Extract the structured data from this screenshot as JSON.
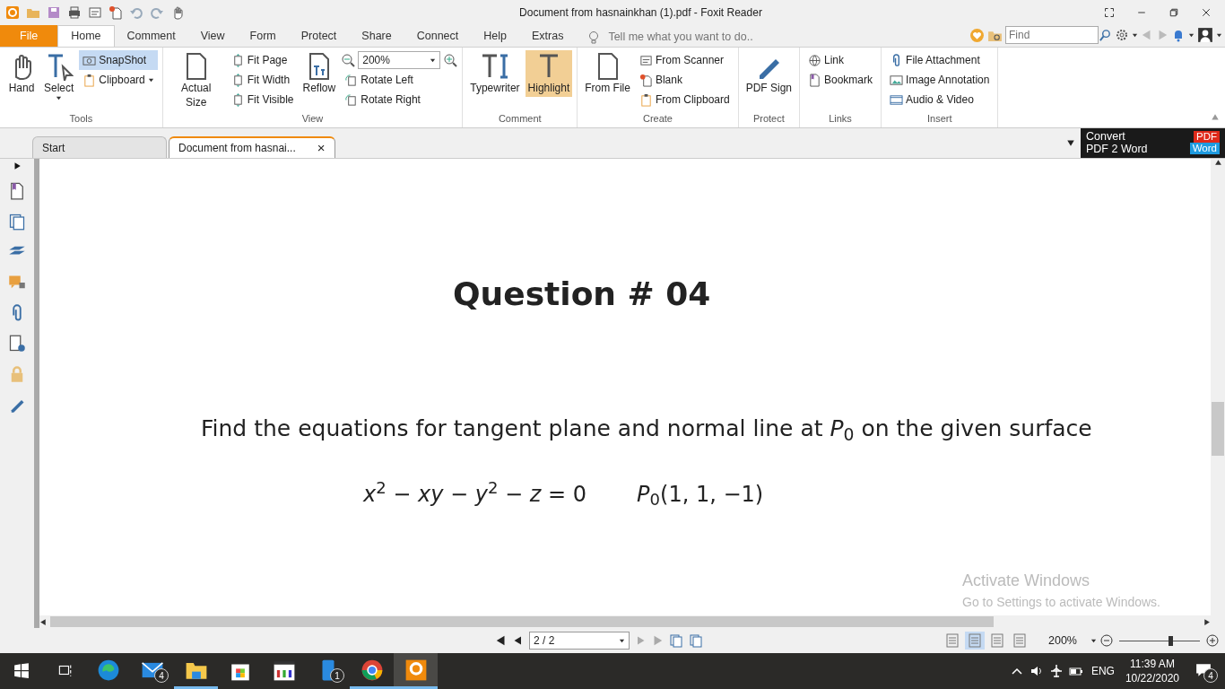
{
  "window": {
    "title": "Document from hasnainkhan (1).pdf - Foxit Reader"
  },
  "quick_access": [
    {
      "kind": "app"
    },
    {
      "kind": "open"
    },
    {
      "kind": "save"
    },
    {
      "kind": "print"
    },
    {
      "kind": "scan"
    },
    {
      "kind": "new"
    },
    {
      "kind": "undo"
    },
    {
      "kind": "redo"
    },
    {
      "kind": "hand"
    }
  ],
  "ribbon_tabs": [
    {
      "label": "File",
      "kind": "file",
      "selected": false
    },
    {
      "label": "Home",
      "kind": "tab",
      "selected": true
    },
    {
      "label": "Comment",
      "kind": "tab",
      "selected": false
    },
    {
      "label": "View",
      "kind": "tab",
      "selected": false
    },
    {
      "label": "Form",
      "kind": "tab",
      "selected": false
    },
    {
      "label": "Protect",
      "kind": "tab",
      "selected": false
    },
    {
      "label": "Share",
      "kind": "tab",
      "selected": false
    },
    {
      "label": "Connect",
      "kind": "tab",
      "selected": false
    },
    {
      "label": "Help",
      "kind": "tab",
      "selected": false
    },
    {
      "label": "Extras",
      "kind": "tab",
      "selected": false
    }
  ],
  "tell_me": {
    "placeholder": "Tell me what you want to do.."
  },
  "find": {
    "placeholder": "Find"
  },
  "ribbon_groups": [
    {
      "label": "Tools",
      "columns": [
        [
          {
            "label": "Hand",
            "kind": "large",
            "active": false
          }
        ],
        [
          {
            "label": "Select",
            "kind": "large",
            "active": false,
            "dropdown": true
          }
        ],
        [
          {
            "label": "SnapShot",
            "kind": "small",
            "active": true
          },
          {
            "label": "Clipboard",
            "kind": "small",
            "active": false,
            "dropdown": true
          }
        ]
      ]
    },
    {
      "label": "View",
      "columns": [
        [
          {
            "label": "Actual Size",
            "kind": "large",
            "active": false
          }
        ],
        [
          {
            "label": "Fit Page",
            "kind": "small",
            "active": false
          },
          {
            "label": "Fit Width",
            "kind": "small",
            "active": false
          },
          {
            "label": "Fit Visible",
            "kind": "small",
            "active": false
          }
        ],
        [
          {
            "label": "Reflow",
            "kind": "large",
            "active": false
          }
        ],
        [
          {
            "label": "200%",
            "kind": "zoom",
            "active": false
          },
          {
            "label": "Rotate Left",
            "kind": "small",
            "active": false
          },
          {
            "label": "Rotate Right",
            "kind": "small",
            "active": false
          }
        ]
      ]
    },
    {
      "label": "Comment",
      "columns": [
        [
          {
            "label": "Typewriter",
            "kind": "large",
            "active": false
          }
        ],
        [
          {
            "label": "Highlight",
            "kind": "large",
            "active": true
          }
        ]
      ]
    },
    {
      "label": "Create",
      "columns": [
        [
          {
            "label": "From File",
            "kind": "large",
            "active": false
          }
        ],
        [
          {
            "label": "From Scanner",
            "kind": "small",
            "active": false
          },
          {
            "label": "Blank",
            "kind": "small",
            "active": false
          },
          {
            "label": "From Clipboard",
            "kind": "small",
            "active": false
          }
        ]
      ]
    },
    {
      "label": "Protect",
      "columns": [
        [
          {
            "label": "PDF Sign",
            "kind": "large",
            "active": false
          }
        ]
      ]
    },
    {
      "label": "Links",
      "columns": [
        [
          {
            "label": "Link",
            "kind": "small",
            "active": false
          },
          {
            "label": "Bookmark",
            "kind": "small",
            "active": false
          }
        ]
      ]
    },
    {
      "label": "Insert",
      "columns": [
        [
          {
            "label": "File Attachment",
            "kind": "small",
            "active": false
          },
          {
            "label": "Image Annotation",
            "kind": "small",
            "active": false
          },
          {
            "label": "Audio & Video",
            "kind": "small",
            "active": false
          }
        ]
      ]
    }
  ],
  "doc_tabs": [
    {
      "label": "Start",
      "selected": false
    },
    {
      "label": "Document from hasnai...",
      "selected": true,
      "close": "×"
    }
  ],
  "convert_ad": {
    "line_1": "Convert",
    "line_2": "PDF 2 Word",
    "badge_1": "PDF",
    "badge_2": "Word"
  },
  "sidebar": [
    {
      "kind": "bookmark"
    },
    {
      "kind": "pages"
    },
    {
      "kind": "layers"
    },
    {
      "kind": "comments"
    },
    {
      "kind": "clip"
    },
    {
      "kind": "signature"
    },
    {
      "kind": "lock"
    },
    {
      "kind": "pen"
    }
  ],
  "document": {
    "heading": "Question # 04",
    "sentence": "Find the equations for tangent plane and normal line at *P*$_{0}$ on the given surface",
    "equation": "*x*$^{2}$ − *xy* − *y*$^{2}$ − *z* = 0",
    "point": "*P*$_{0}$(1, 1, −1)"
  },
  "activation": {
    "title": "Activate Windows",
    "text": "Go to Settings to activate Windows."
  },
  "status_bar": {
    "page": "2 / 2",
    "zoom": "200%",
    "zoom_level": {
      "level": 0.64
    },
    "views": [
      {
        "selected": false
      },
      {
        "selected": true
      },
      {
        "selected": false
      },
      {
        "selected": false
      }
    ]
  },
  "taskbar": {
    "apps": [
      {
        "kind": "edge",
        "running": false,
        "active": false
      },
      {
        "kind": "mail",
        "badge": "4",
        "running": false,
        "active": false
      },
      {
        "kind": "folder",
        "running": true,
        "active": false
      },
      {
        "kind": "store",
        "running": false,
        "active": false
      },
      {
        "kind": "player",
        "running": false,
        "active": false
      },
      {
        "kind": "phone",
        "badge": "1",
        "running": false,
        "active": false
      },
      {
        "kind": "chrome",
        "running": true,
        "active": false
      },
      {
        "kind": "foxit",
        "running": true,
        "active": true
      }
    ],
    "language": "ENG",
    "time": "11:39 AM",
    "date": "10/22/2020",
    "notifications": "4"
  }
}
